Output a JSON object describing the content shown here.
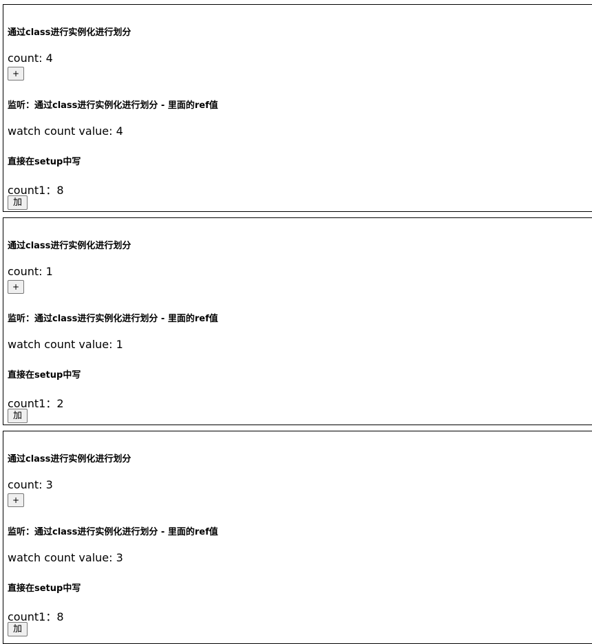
{
  "panels": [
    {
      "title1": "通过class进行实例化进行划分",
      "count_label": "count: 4",
      "plus_label": "+",
      "title2": "监听：通过class进行实例化进行划分 - 里面的ref值",
      "watch_label": "watch count value: 4",
      "title3": "直接在setup中写",
      "count1_label": "count1：8",
      "add_label": "加"
    },
    {
      "title1": "通过class进行实例化进行划分",
      "count_label": "count: 1",
      "plus_label": "+",
      "title2": "监听：通过class进行实例化进行划分 - 里面的ref值",
      "watch_label": "watch count value: 1",
      "title3": "直接在setup中写",
      "count1_label": "count1：2",
      "add_label": "加"
    },
    {
      "title1": "通过class进行实例化进行划分",
      "count_label": "count: 3",
      "plus_label": "+",
      "title2": "监听：通过class进行实例化进行划分 - 里面的ref值",
      "watch_label": "watch count value: 3",
      "title3": "直接在setup中写",
      "count1_label": "count1：8",
      "add_label": "加"
    }
  ]
}
